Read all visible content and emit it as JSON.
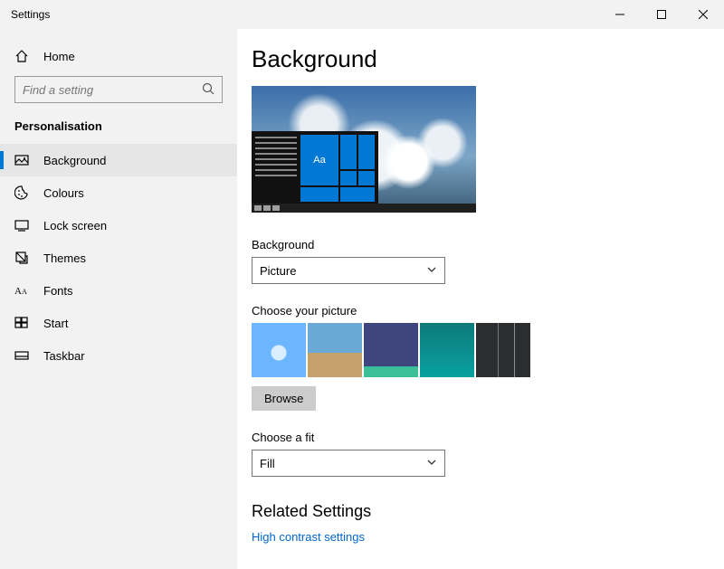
{
  "window": {
    "title": "Settings"
  },
  "sidebar": {
    "home_label": "Home",
    "search_placeholder": "Find a setting",
    "category_label": "Personalisation",
    "items": [
      {
        "label": "Background"
      },
      {
        "label": "Colours"
      },
      {
        "label": "Lock screen"
      },
      {
        "label": "Themes"
      },
      {
        "label": "Fonts"
      },
      {
        "label": "Start"
      },
      {
        "label": "Taskbar"
      }
    ]
  },
  "content": {
    "page_title": "Background",
    "preview_tile_label": "Aa",
    "background_label": "Background",
    "background_value": "Picture",
    "choose_picture_label": "Choose your picture",
    "browse_label": "Browse",
    "choose_fit_label": "Choose a fit",
    "fit_value": "Fill",
    "related_title": "Related Settings",
    "links": [
      {
        "label": "High contrast settings"
      }
    ]
  }
}
